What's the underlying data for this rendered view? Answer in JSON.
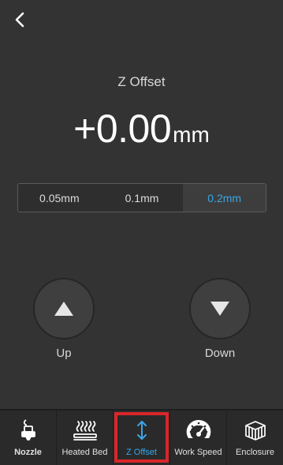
{
  "header": {
    "back_icon": "chevron-left-icon"
  },
  "title": "Z Offset",
  "value": {
    "number": "+0.00",
    "unit": "mm"
  },
  "step_options": [
    {
      "label": "0.05mm",
      "selected": false
    },
    {
      "label": "0.1mm",
      "selected": false
    },
    {
      "label": "0.2mm",
      "selected": true
    }
  ],
  "controls": {
    "up_label": "Up",
    "down_label": "Down",
    "up_icon": "triangle-up-icon",
    "down_icon": "triangle-down-icon"
  },
  "tabs": [
    {
      "label": "Nozzle",
      "icon": "nozzle-icon",
      "bold": true,
      "active": false
    },
    {
      "label": "Heated Bed",
      "icon": "heated-bed-icon",
      "bold": false,
      "active": false
    },
    {
      "label": "Z Offset",
      "icon": "z-offset-icon",
      "bold": false,
      "active": true
    },
    {
      "label": "Work Speed",
      "icon": "speedometer-icon",
      "bold": false,
      "active": false
    },
    {
      "label": "Enclosure",
      "icon": "enclosure-icon",
      "bold": false,
      "active": false
    }
  ],
  "colors": {
    "accent": "#39a6e8",
    "background": "#333333",
    "highlight_border": "#d9262a"
  }
}
